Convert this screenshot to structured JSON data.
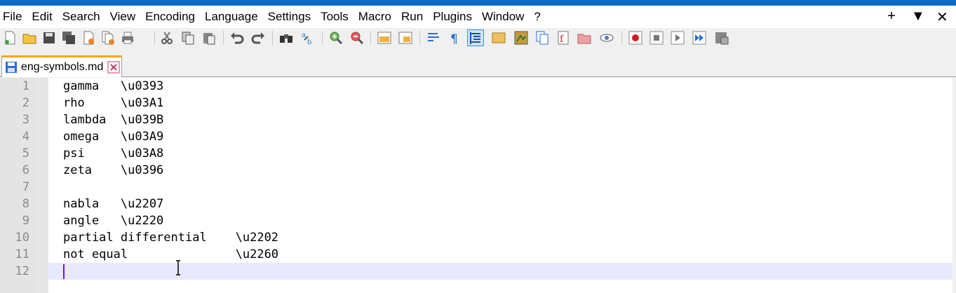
{
  "menu": [
    "File",
    "Edit",
    "Search",
    "View",
    "Encoding",
    "Language",
    "Settings",
    "Tools",
    "Macro",
    "Run",
    "Plugins",
    "Window",
    "?"
  ],
  "window_controls": {
    "add": "+",
    "dropdown": "▼",
    "close": "✕"
  },
  "tab": {
    "filename": "eng-symbols.md",
    "icon": "save-disk-icon",
    "close_icon": "close-tab-icon"
  },
  "lines": [
    {
      "num": "1",
      "text": "gamma   \\u0393"
    },
    {
      "num": "2",
      "text": "rho     \\u03A1"
    },
    {
      "num": "3",
      "text": "lambda  \\u039B"
    },
    {
      "num": "4",
      "text": "omega   \\u03A9"
    },
    {
      "num": "5",
      "text": "psi     \\u03A8"
    },
    {
      "num": "6",
      "text": "zeta    \\u0396"
    },
    {
      "num": "7",
      "text": ""
    },
    {
      "num": "8",
      "text": "nabla   \\u2207"
    },
    {
      "num": "9",
      "text": "angle   \\u2220"
    },
    {
      "num": "10",
      "text": "partial differential    \\u2202"
    },
    {
      "num": "11",
      "text": "not equal               \\u2260"
    },
    {
      "num": "12",
      "text": ""
    }
  ],
  "colors": {
    "titlebar": "#0d6bc5",
    "current_line": "#e8e8ff",
    "caret": "#8000ff",
    "tab_accent": "#f5a623"
  }
}
